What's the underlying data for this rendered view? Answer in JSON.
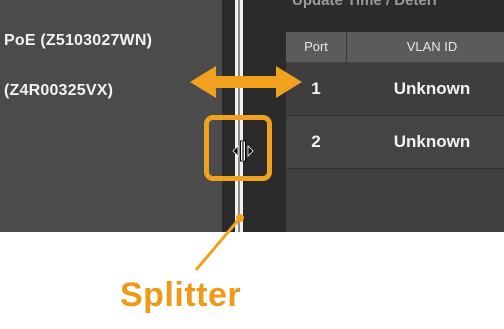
{
  "devices": [
    {
      "label": "PoE (Z5103027WN)"
    },
    {
      "label": "(Z4R00325VX)"
    }
  ],
  "panel": {
    "title": "Update Time / Deterr"
  },
  "table": {
    "columns": [
      "Port",
      "VLAN ID"
    ],
    "rows": [
      {
        "port": "1",
        "vlan": "Unknown"
      },
      {
        "port": "2",
        "vlan": "Unknown"
      }
    ]
  },
  "annotation": {
    "label": "Splitter",
    "accent_color": "#f0a21e"
  },
  "icons": [
    "resize-arrow-icon",
    "column-resize-cursor-icon"
  ]
}
